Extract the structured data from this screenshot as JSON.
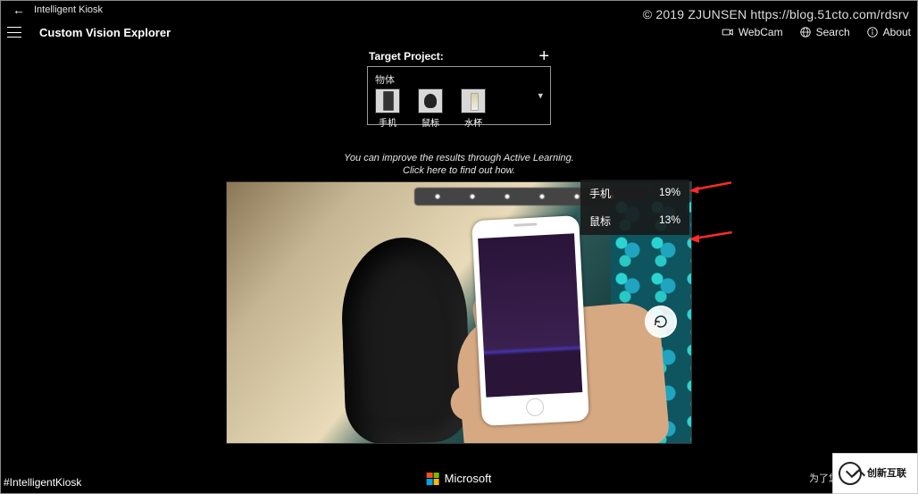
{
  "titlebar": {
    "app_name": "Intelligent Kiosk"
  },
  "subbar": {
    "page_title": "Custom Vision Explorer",
    "nav": {
      "webcam": "WebCam",
      "search": "Search",
      "about": "About"
    }
  },
  "watermark": "© 2019 ZJUNSEN https://blog.51cto.com/rdsrv",
  "target": {
    "header": "Target Project:",
    "project_name": "物体",
    "tags": [
      {
        "label": "手机"
      },
      {
        "label": "鼠标"
      },
      {
        "label": "水杯"
      }
    ]
  },
  "hint": {
    "line1": "You can improve the results through Active Learning.",
    "line2": "Click here to find out how."
  },
  "results": [
    {
      "label": "手机",
      "value": "19%"
    },
    {
      "label": "鼠标",
      "value": "13%"
    }
  ],
  "footer": {
    "hashtag": "#IntelligentKiosk",
    "brand": "Microsoft",
    "right_text": "为了您的"
  },
  "badge": {
    "text": "创新互联"
  }
}
